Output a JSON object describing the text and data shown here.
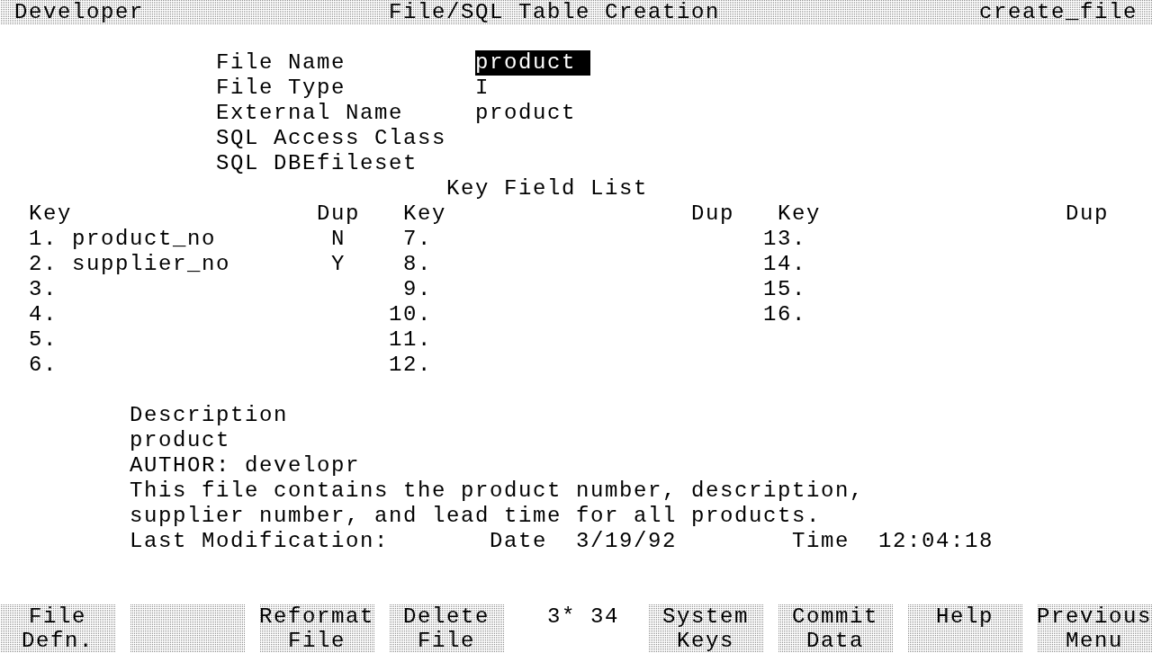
{
  "header": {
    "app": "Developer",
    "title": "File/SQL Table Creation",
    "screen": "create_file"
  },
  "fields": [
    {
      "label": "File Name",
      "value": "product",
      "focused": true
    },
    {
      "label": "File Type",
      "value": "I",
      "focused": false
    },
    {
      "label": "External Name",
      "value": "product",
      "focused": false
    },
    {
      "label": "SQL Access Class",
      "focused": false
    },
    {
      "label": "SQL DBEfileset",
      "focused": false
    }
  ],
  "key_field_list": {
    "title": "Key Field List",
    "groups": [
      {
        "key_header": "Key",
        "dup_header": "Dup",
        "rows": [
          {
            "number": "1.",
            "field": "product_no",
            "dup": "N"
          },
          {
            "number": "2.",
            "field": "supplier_no",
            "dup": "Y"
          },
          {
            "number": "3."
          },
          {
            "number": "4."
          },
          {
            "number": "5."
          },
          {
            "number": "6."
          }
        ]
      },
      {
        "key_header": "Key",
        "dup_header": "Dup",
        "rows": [
          {
            "number": "7."
          },
          {
            "number": "8."
          },
          {
            "number": "9."
          },
          {
            "number": "10."
          },
          {
            "number": "11."
          },
          {
            "number": "12."
          }
        ]
      },
      {
        "key_header": "Key",
        "dup_header": "Dup",
        "rows": [
          {
            "number": "13."
          },
          {
            "number": "14."
          },
          {
            "number": "15."
          },
          {
            "number": "16."
          }
        ]
      }
    ]
  },
  "description": {
    "label": "Description",
    "lines": [
      "product",
      "AUTHOR: developr",
      "This file contains the product number, description,",
      "supplier number, and lead time for all products."
    ]
  },
  "last_modification": {
    "label": "Last Modification:",
    "date_label": "Date",
    "date": "3/19/92",
    "time_label": "Time",
    "time": "12:04:18"
  },
  "function_keys": [
    {
      "kind": "labeled",
      "lines": [
        "File",
        "Defn."
      ]
    },
    {
      "kind": "blank"
    },
    {
      "kind": "labeled",
      "lines": [
        "Reformat",
        "File"
      ]
    },
    {
      "kind": "labeled",
      "lines": [
        "Delete",
        "File"
      ]
    },
    {
      "kind": "labeled",
      "lines": [
        "System",
        "Keys"
      ]
    },
    {
      "kind": "labeled",
      "lines": [
        "Commit",
        "Data"
      ]
    },
    {
      "kind": "labeled",
      "lines": [
        "Help"
      ]
    },
    {
      "kind": "labeled",
      "lines": [
        "Previous",
        "Menu"
      ]
    }
  ],
  "status": "3* 34"
}
